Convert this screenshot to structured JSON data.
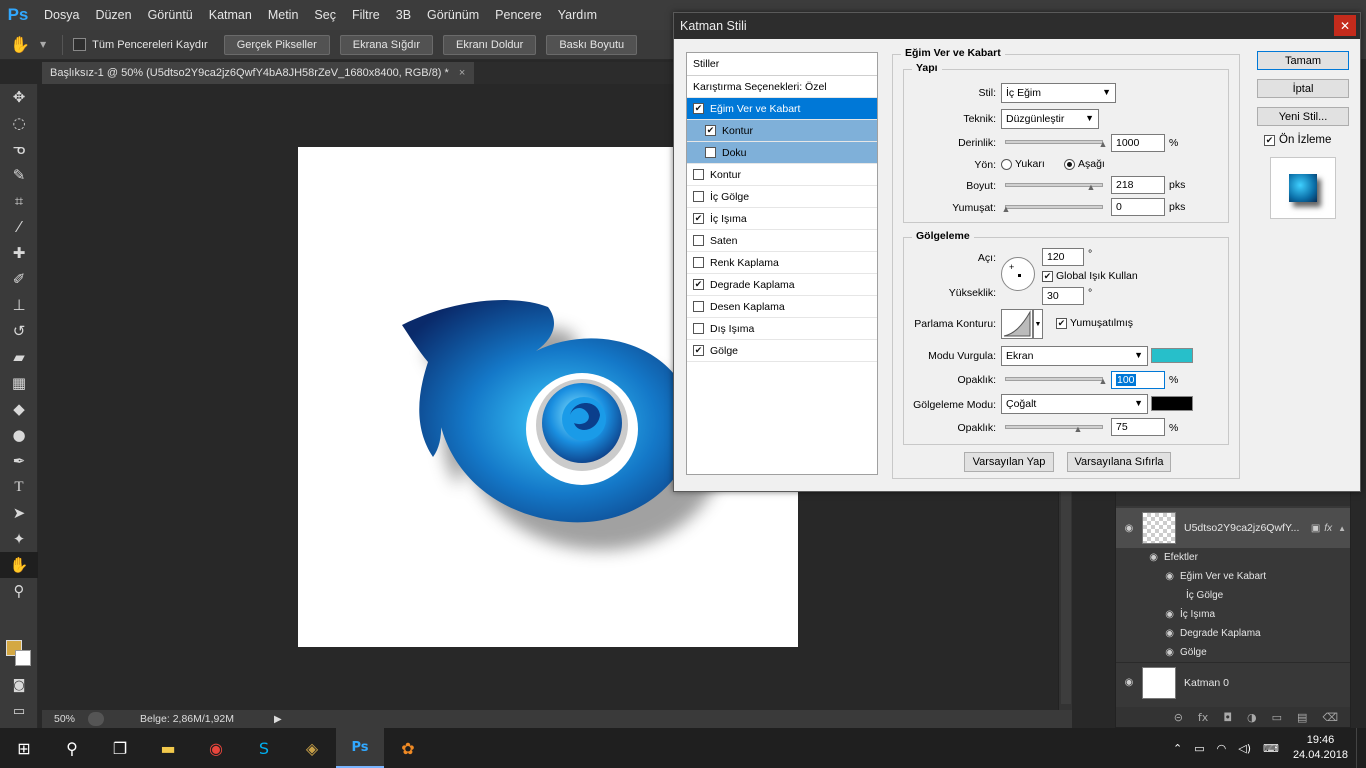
{
  "app": {
    "logo": "Ps",
    "menu": [
      "Dosya",
      "Düzen",
      "Görüntü",
      "Katman",
      "Metin",
      "Seç",
      "Filtre",
      "3B",
      "Görünüm",
      "Pencere",
      "Yardım"
    ]
  },
  "options_bar": {
    "scroll_all_label": "Tüm Pencereleri Kaydır",
    "buttons": [
      "Gerçek Pikseller",
      "Ekrana Sığdır",
      "Ekranı Doldur",
      "Baskı Boyutu"
    ]
  },
  "document": {
    "tab_title": "Başlıksız-1 @ 50% (U5dtso2Y9ca2jz6QwfY4bA8JH58rZeV_1680x8400, RGB/8) *",
    "zoom": "50%",
    "doc_info": "Belge: 2,86M/1,92M"
  },
  "colors": {
    "foreground": "#d4a843",
    "background": "#ffffff",
    "highlight_swatch": "#27bfca",
    "shadow_swatch": "#000000"
  },
  "dialog": {
    "title": "Katman Stili",
    "styles_header": "Stiller",
    "blend_options": "Karıştırma Seçenekleri: Özel",
    "styles": [
      {
        "label": "Eğim Ver ve Kabart",
        "checked": true
      },
      {
        "label": "Kontur",
        "checked": true
      },
      {
        "label": "Doku",
        "checked": false
      },
      {
        "label": "Kontur",
        "checked": false
      },
      {
        "label": "İç Gölge",
        "checked": false
      },
      {
        "label": "İç Işıma",
        "checked": true
      },
      {
        "label": "Saten",
        "checked": false
      },
      {
        "label": "Renk Kaplama",
        "checked": false
      },
      {
        "label": "Degrade Kaplama",
        "checked": true
      },
      {
        "label": "Desen Kaplama",
        "checked": false
      },
      {
        "label": "Dış Işıma",
        "checked": false
      },
      {
        "label": "Gölge",
        "checked": true
      }
    ],
    "section_title": "Eğim Ver ve Kabart",
    "structure": {
      "title": "Yapı",
      "style_label": "Stil:",
      "style_value": "İç Eğim",
      "technique_label": "Teknik:",
      "technique_value": "Düzgünleştir",
      "depth_label": "Derinlik:",
      "depth_value": "1000",
      "depth_unit": "%",
      "direction_label": "Yön:",
      "direction_up": "Yukarı",
      "direction_down": "Aşağı",
      "size_label": "Boyut:",
      "size_value": "218",
      "size_unit": "pks",
      "soften_label": "Yumuşat:",
      "soften_value": "0",
      "soften_unit": "pks"
    },
    "shading": {
      "title": "Gölgeleme",
      "angle_label": "Açı:",
      "angle_value": "120",
      "degree": "°",
      "global_light": "Global Işık Kullan",
      "altitude_label": "Yükseklik:",
      "altitude_value": "30",
      "gloss_label": "Parlama Konturu:",
      "antialias": "Yumuşatılmış",
      "highlight_mode_label": "Modu Vurgula:",
      "highlight_mode": "Ekran",
      "opacity_label": "Opaklık:",
      "highlight_opacity": "100",
      "percent": "%",
      "shadow_mode_label": "Gölgeleme Modu:",
      "shadow_mode": "Çoğalt",
      "shadow_opacity": "75"
    },
    "make_default": "Varsayılan Yap",
    "reset_default": "Varsayılana Sıfırla",
    "ok": "Tamam",
    "cancel": "İptal",
    "new_style": "Yeni Stil...",
    "preview": "Ön İzleme"
  },
  "layers": {
    "layer1_name": "U5dtso2Y9ca2jz6QwfY...",
    "effects_label": "Efektler",
    "effects": [
      "Eğim Ver ve Kabart",
      "İç Gölge",
      "İç Işıma",
      "Degrade Kaplama",
      "Gölge"
    ],
    "layer0_name": "Katman 0"
  },
  "taskbar": {
    "time": "19:46",
    "date": "24.04.2018"
  }
}
